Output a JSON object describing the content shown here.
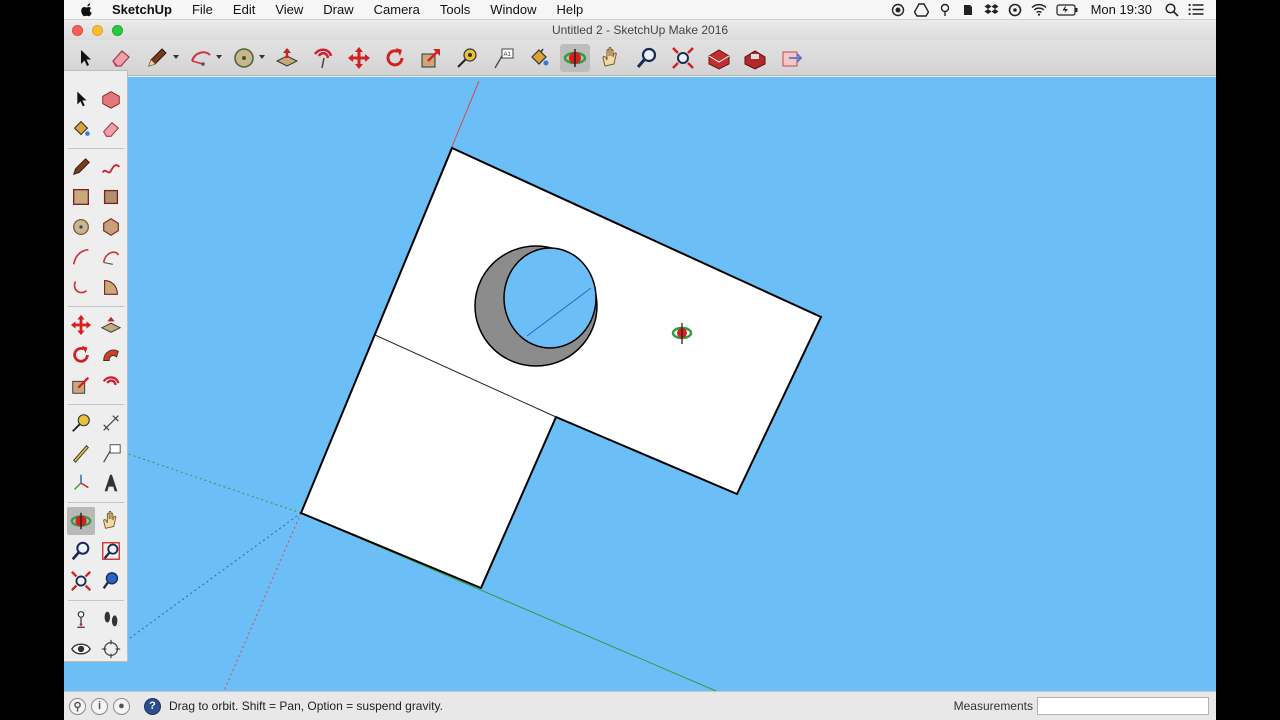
{
  "menubar": {
    "app_name": "SketchUp",
    "menus": [
      "File",
      "Edit",
      "View",
      "Draw",
      "Camera",
      "Tools",
      "Window",
      "Help"
    ],
    "clock": "Mon 19:30"
  },
  "window": {
    "title": "Untitled 2 - SketchUp Make 2016"
  },
  "toolbar": {
    "tools": [
      "select",
      "eraser",
      "line",
      "arc",
      "shapes",
      "push-pull",
      "offset",
      "move",
      "rotate",
      "scale",
      "tape-measure",
      "text",
      "paint-bucket",
      "orbit",
      "pan",
      "zoom",
      "zoom-extents",
      "3d-warehouse",
      "extension-warehouse",
      "layout"
    ],
    "active_tool": "orbit"
  },
  "palette": {
    "tools": [
      "select",
      "make-component",
      "paint-bucket",
      "eraser",
      "line",
      "freehand",
      "rectangle",
      "rotated-rectangle",
      "circle",
      "polygon",
      "arc",
      "2-point-arc",
      "3-point-arc",
      "pie",
      "move",
      "push-pull",
      "rotate",
      "follow-me",
      "scale",
      "offset",
      "tape-measure",
      "dimension",
      "protractor",
      "text",
      "axes",
      "3d-text",
      "orbit",
      "pan",
      "zoom",
      "zoom-window",
      "zoom-extents",
      "previous",
      "position-camera",
      "walk",
      "look-around",
      "section-plane"
    ],
    "active_tool": "orbit"
  },
  "colors": {
    "sky": "#6cbff6",
    "face": "#ffffff",
    "hole": "#8c8c8c",
    "axis_red": "#d84a4a",
    "axis_green": "#2f9e3f",
    "axis_blue": "#2b62c8"
  },
  "statusbar": {
    "hint": "Drag to orbit. Shift = Pan, Option = suspend gravity.",
    "measurements_label": "Measurements",
    "measurements_value": ""
  }
}
